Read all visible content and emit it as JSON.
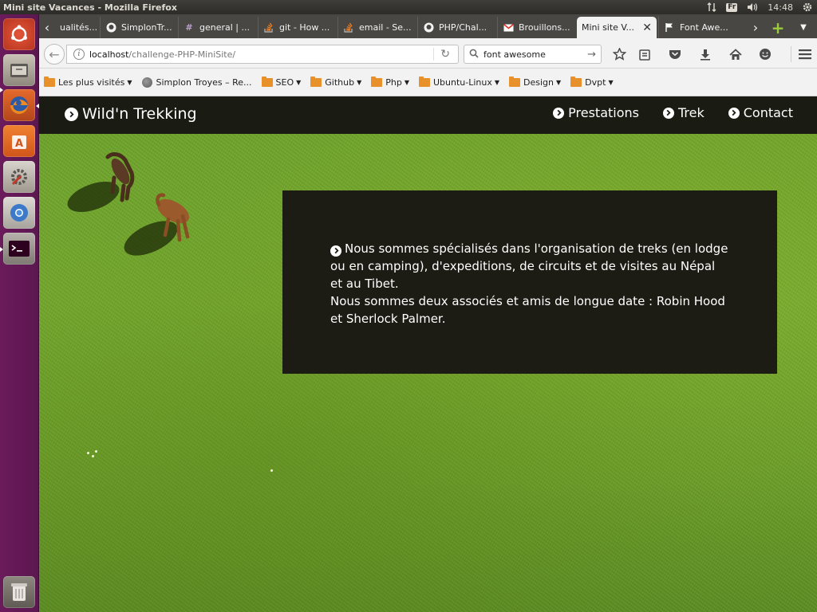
{
  "panel": {
    "window_title": "Mini site Vacances - Mozilla Firefox",
    "keyboard": "Fr",
    "time": "14:48"
  },
  "tabs": [
    {
      "label": "ualités...",
      "icon": "page-icon"
    },
    {
      "label": "SimplonTr...",
      "icon": "github-icon"
    },
    {
      "label": "general | ...",
      "icon": "slack-icon"
    },
    {
      "label": "git - How ...",
      "icon": "stackoverflow-icon"
    },
    {
      "label": "email - Se...",
      "icon": "stackoverflow-icon"
    },
    {
      "label": "PHP/Chal...",
      "icon": "github-icon"
    },
    {
      "label": "Brouillons...",
      "icon": "gmail-icon"
    },
    {
      "label": "Mini site V...",
      "icon": "none",
      "active": true
    },
    {
      "label": "Font Awe...",
      "icon": "flag-icon"
    }
  ],
  "nav": {
    "url_host": "localhost",
    "url_path": "/challenge-PHP-MiniSite/",
    "search_value": "font awesome"
  },
  "bookmarks": [
    {
      "label": "Les plus visités",
      "icon": "folder-icon",
      "dropdown": true
    },
    {
      "label": "Simplon Troyes – Re...",
      "icon": "globe-icon",
      "dropdown": false
    },
    {
      "label": "SEO",
      "icon": "folder-icon",
      "dropdown": true
    },
    {
      "label": "Github",
      "icon": "folder-icon",
      "dropdown": true
    },
    {
      "label": "Php",
      "icon": "folder-icon",
      "dropdown": true
    },
    {
      "label": "Ubuntu-Linux",
      "icon": "folder-icon",
      "dropdown": true
    },
    {
      "label": "Design",
      "icon": "folder-icon",
      "dropdown": true
    },
    {
      "label": "Dvpt",
      "icon": "folder-icon",
      "dropdown": true
    }
  ],
  "site": {
    "brand": "Wild'n Trekking",
    "menu": [
      "Prestations",
      "Trek",
      "Contact"
    ],
    "intro_line1": "Nous sommes spécialisés dans l'organisation de treks (en lodge ou en camping), d'expeditions, de circuits et de visites au Népal et au Tibet.",
    "intro_line2": "Nous sommes deux associés et amis de longue date : Robin Hood et Sherlock Palmer."
  },
  "colors": {
    "site_nav_bg": "#1a1b12",
    "info_box_bg": "#1d1c14",
    "launcher_bg": "#6a1b5b",
    "grass": "#72a82e"
  }
}
